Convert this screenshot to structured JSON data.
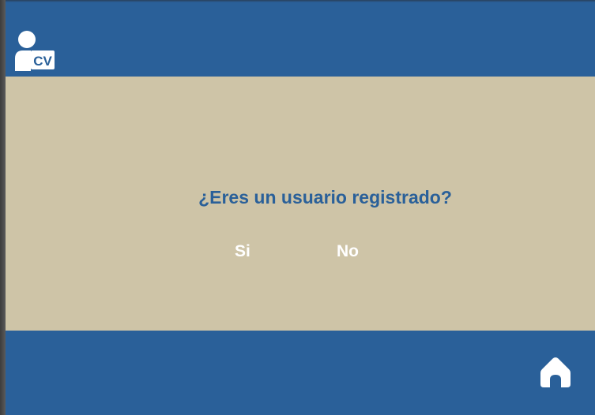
{
  "header": {
    "logo_text": "CV"
  },
  "main": {
    "question": "¿Eres un usuario registrado?",
    "yes_label": "Si",
    "no_label": "No"
  },
  "footer": {
    "home_icon": "home-icon"
  },
  "colors": {
    "primary": "#2a6099",
    "background": "#cec4a7",
    "text_on_primary": "#ffffff"
  }
}
